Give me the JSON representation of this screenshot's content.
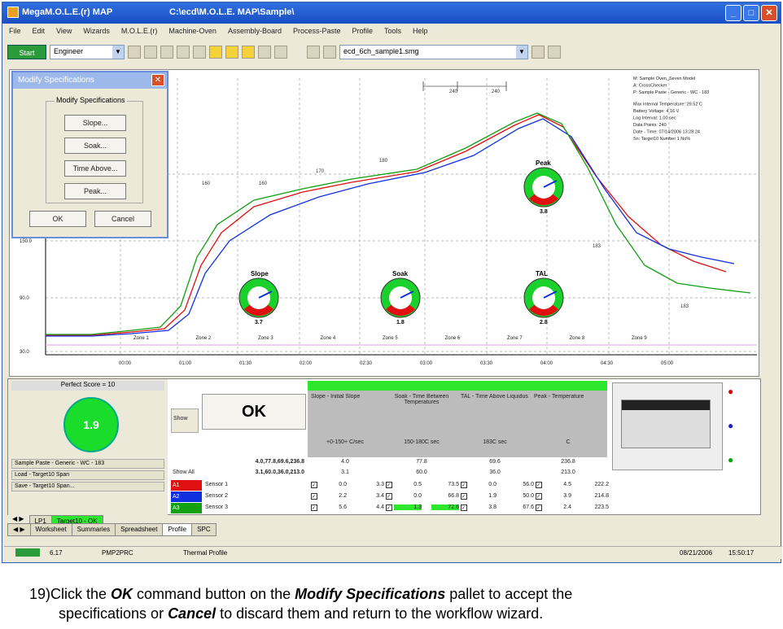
{
  "window": {
    "title": "MegaM.O.L.E.(r) MAP",
    "path": "C:\\ecd\\M.O.L.E. MAP\\Sample\\"
  },
  "menu": [
    "File",
    "Edit",
    "View",
    "Wizards",
    "M.O.L.E.(r)",
    "Machine-Oven",
    "Assembly-Board",
    "Process-Paste",
    "Profile",
    "Tools",
    "Help"
  ],
  "toolbar": {
    "start": "Start",
    "user": "Engineer",
    "file": "ecd_6ch_sample1.smg"
  },
  "legend_lines": [
    "M: Sample Oven_Seven Model",
    "A: CrossChecker",
    "P: Sample Paste - Generic - WC - 183",
    "Max Internal Temperature: 29.52 C",
    "Battery Voltage: 4.16 V",
    "Log Interval: 1.00 sec",
    "Data Points: 240",
    "Date - Time: 07/14/2006 13:28:24",
    "Sn: Target10 Number 1 No%"
  ],
  "y_ticks": [
    "150.0",
    "90.0",
    "30.0"
  ],
  "x_ticks": [
    "00:00",
    "01:00",
    "01:30",
    "02:00",
    "02:30",
    "03:00",
    "03:30",
    "04:00",
    "04:30",
    "05:00"
  ],
  "zones": [
    "Zone 1",
    "Zone 2",
    "Zone 3",
    "Zone 4",
    "Zone 5",
    "Zone 6",
    "Zone 7",
    "Zone 8",
    "Zone 9"
  ],
  "top_labels": [
    "240",
    "240"
  ],
  "gauges": [
    {
      "label": "Slope",
      "value": "3.7"
    },
    {
      "label": "Soak",
      "value": "1.8"
    },
    {
      "label": "Peak",
      "value": "3.8"
    },
    {
      "label": "TAL",
      "value": "2.8"
    }
  ],
  "dialog": {
    "title": "Modify Specifications",
    "group": "Modify Specifications",
    "buttons": [
      "Slope...",
      "Soak...",
      "Time Above...",
      "Peak..."
    ],
    "ok": "OK",
    "cancel": "Cancel"
  },
  "bottom": {
    "perfect": "Perfect Score = 10",
    "score": "1.9",
    "ok": "OK",
    "show": "Show",
    "upper": [
      "4.0",
      "77.8",
      "69.6",
      "236.8"
    ],
    "lower": [
      "3.1",
      "60.0",
      "36.0",
      "213.0"
    ],
    "show_all": "Show All",
    "left_rows": [
      "Sample Paste - Generic - WC - 183",
      "Load - Target10 Span",
      "Save - Target10 Span..."
    ],
    "headers": [
      "Slope - Initial Slope",
      "Soak - Time Between Temperatures",
      "TAL - Time Above Liquidus",
      "Peak - Temperature"
    ],
    "specs": [
      "+0-150+ C/sec",
      "150-180C sec",
      "183C sec",
      "C"
    ],
    "sensors": [
      {
        "id": "A1",
        "name": "Sensor 1",
        "color": "#e01010",
        "vals": [
          "0.0",
          "3.3",
          "0.5",
          "73.5",
          "0.0",
          "56.0",
          "4.5",
          "222.2"
        ]
      },
      {
        "id": "A2",
        "name": "Sensor 2",
        "color": "#1030e0",
        "vals": [
          "2.2",
          "3.4",
          "0.0",
          "66.8",
          "1.9",
          "50.0",
          "3.9",
          "214.8"
        ]
      },
      {
        "id": "A3",
        "name": "Sensor 3",
        "color": "#10a010",
        "vals": [
          "5.6",
          "4.4",
          "1.3",
          "72.6",
          "3.8",
          "67.6",
          "2.4",
          "223.5"
        ]
      }
    ]
  },
  "subtabs": [
    "LP1",
    "Target10 - OK"
  ],
  "tabs": [
    "Worksheet",
    "Summaries",
    "Spreadsheet",
    "Profile",
    "SPC"
  ],
  "status": {
    "left": "6.17",
    "mid": "PMP2PRC",
    "right": "Thermal Profile",
    "date": "08/21/2006",
    "time": "15:50:17"
  },
  "caption": {
    "num": "19)",
    "a": "Click the ",
    "ok": "OK",
    "b": " command button on the ",
    "ms": "Modify Specifications",
    "c": " pallet to accept the",
    "d": "specifications or ",
    "cancel": "Cancel",
    "e": " to discard them and return to the workflow wizard."
  }
}
